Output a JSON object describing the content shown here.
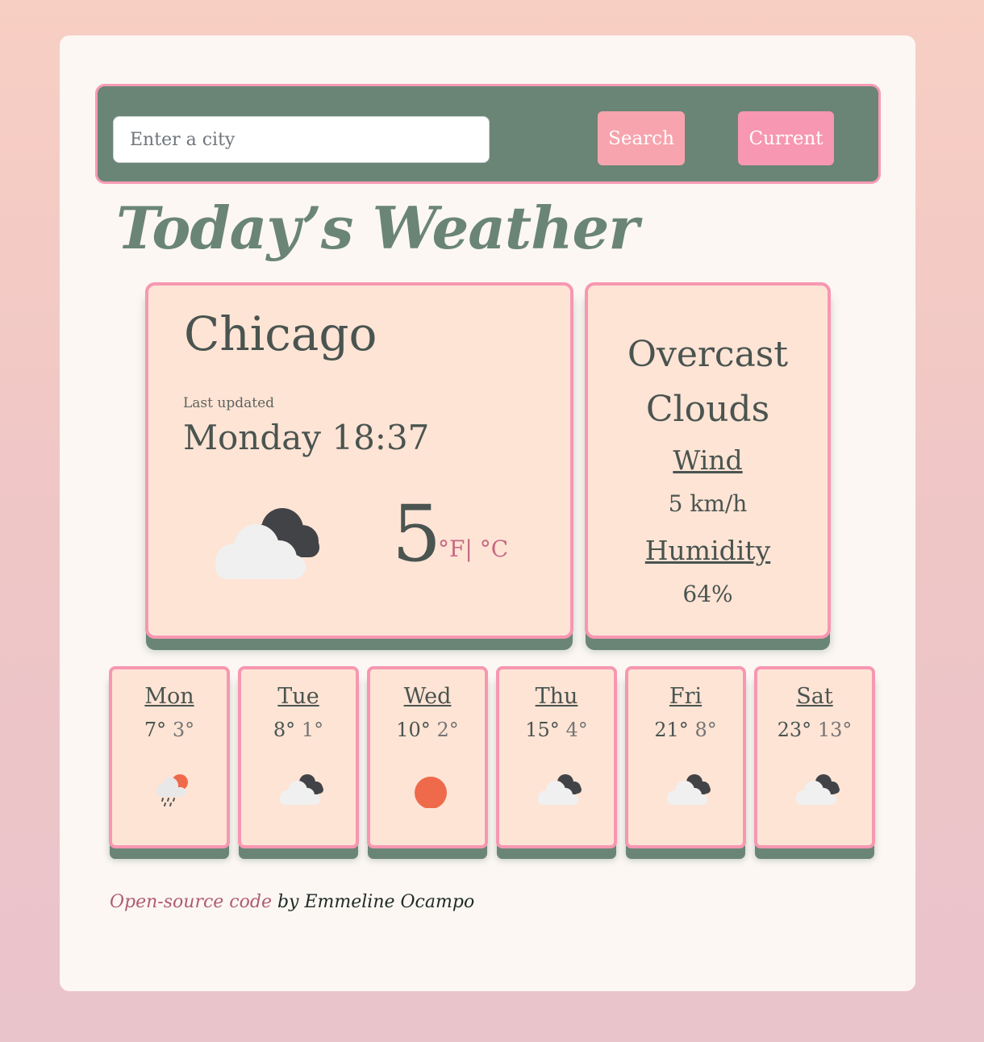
{
  "search": {
    "placeholder": "Enter a city",
    "search_label": "Search",
    "current_label": "Current"
  },
  "title": "Today’s Weather",
  "current": {
    "city": "Chicago",
    "updated_label": "Last updated",
    "updated": "Monday 18:37",
    "icon": "cloudy-icon",
    "temperature": "5",
    "units": "°F| °C",
    "description": "Overcast Clouds",
    "wind_label": "Wind",
    "wind": "5 km/h",
    "humidity_label": "Humidity",
    "humidity": "64%"
  },
  "forecast": [
    {
      "day": "Mon",
      "max": "7°",
      "min": "3°",
      "icon": "rain-sun-icon"
    },
    {
      "day": "Tue",
      "max": "8°",
      "min": "1°",
      "icon": "cloudy-icon"
    },
    {
      "day": "Wed",
      "max": "10°",
      "min": "2°",
      "icon": "sun-icon"
    },
    {
      "day": "Thu",
      "max": "15°",
      "min": "4°",
      "icon": "cloudy-icon"
    },
    {
      "day": "Fri",
      "max": "21°",
      "min": "8°",
      "icon": "cloudy-icon"
    },
    {
      "day": "Sat",
      "max": "23°",
      "min": "13°",
      "icon": "cloudy-icon"
    }
  ],
  "footer": {
    "link_text": "Open-source code",
    "author_text": " by Emmeline Ocampo"
  },
  "colors": {
    "accent_green": "#6a8575",
    "accent_pink": "#f797b1",
    "card_bg": "#fee4d5",
    "sun": "#ef6a4a"
  }
}
